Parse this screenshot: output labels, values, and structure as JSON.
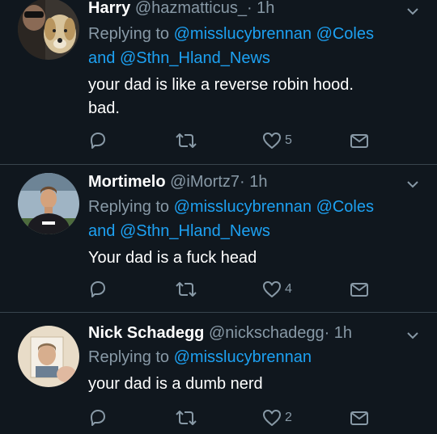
{
  "tweets": [
    {
      "name": "Harry",
      "handle": "@hazmatticus_",
      "time": "· 1h",
      "replying_prefix": "Replying to",
      "mentions_line1": [
        "@misslucybrennan",
        "@Coles"
      ],
      "and_word": "and",
      "mention_line2": "@Sthn_Hland_News",
      "text_lines": [
        "your dad is like a reverse robin hood.",
        "bad."
      ],
      "likes": "5",
      "avatar_icon": "dog-photo-avatar"
    },
    {
      "name": "Mortimelo",
      "handle": "@iMortz7",
      "time": "· 1h",
      "replying_prefix": "Replying to",
      "mentions_line1": [
        "@misslucybrennan",
        "@Coles"
      ],
      "and_word": "and",
      "mention_line2": "@Sthn_Hland_News",
      "text_lines": [
        "Your dad is a fuck head"
      ],
      "likes": "4",
      "avatar_icon": "rugby-player-avatar"
    },
    {
      "name": "Nick Schadegg",
      "handle": "@nickschadegg",
      "time": "· 1h",
      "replying_prefix": "Replying to",
      "mentions_line1": [
        "@misslucybrennan"
      ],
      "text_lines": [
        "your dad is a dumb nerd"
      ],
      "likes": "2",
      "avatar_icon": "photo-portrait-avatar"
    }
  ],
  "colors": {
    "background": "#10171e",
    "divider": "#38444d",
    "secondary_text": "#8899a6",
    "link": "#1da1f2"
  },
  "icons": [
    "reply-icon",
    "retweet-icon",
    "heart-icon",
    "dm-icon",
    "chevron-down-icon"
  ]
}
